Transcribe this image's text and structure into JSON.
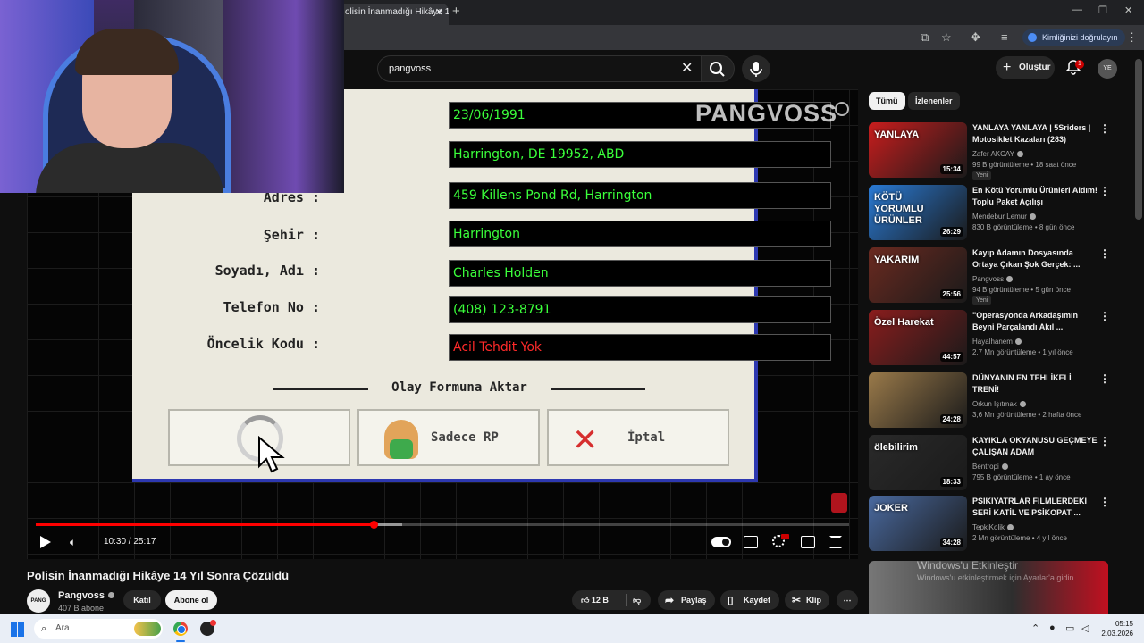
{
  "browser": {
    "tab_title": "olisin İnanmadığı Hikâye 1",
    "id_pill": "Kimliğinizi doğrulayın"
  },
  "header": {
    "search_value": "pangvoss",
    "create_label": "Oluştur",
    "notif_count": "1",
    "avatar_initials": "YE"
  },
  "player": {
    "watermark": "PANGVOSS",
    "form": {
      "partial_values": [
        "23/06/1991",
        "Harrington, DE 19952, ABD"
      ],
      "fields": [
        {
          "label": "Adres :",
          "value": "459 Killens Pond Rd, Harrington"
        },
        {
          "label": "Şehir :",
          "value": "Harrington"
        },
        {
          "label": "Soyadı, Adı :",
          "value": "Charles Holden"
        },
        {
          "label": "Telefon No :",
          "value": "(408) 123-8791"
        },
        {
          "label": "Öncelik Kodu :",
          "value": "Acil Tehdit Yok"
        }
      ],
      "section": "Olay Formuna Aktar",
      "button_rp": "Sadece RP",
      "button_cancel": "İptal"
    },
    "time": "10:30 / 25:17",
    "progress_fraction": 0.4152,
    "buffer_fraction": 0.45
  },
  "video": {
    "title": "Polisin İnanmadığı Hikâye 14 Yıl Sonra Çözüldü",
    "channel": "Pangvoss",
    "channel_logo": "PANG VOSS",
    "subs": "407 B abone",
    "join": "Katıl",
    "subscribe": "Abone ol",
    "likes": "12 B",
    "share": "Paylaş",
    "save": "Kaydet",
    "clip": "Klip"
  },
  "sidebar": {
    "chips": [
      "Tümü",
      "İzlenenler"
    ],
    "videos": [
      {
        "title": "YANLAYA YANLAYA | 5Sriders | Motosiklet Kazaları (283)",
        "channel": "Zafer AKCAY",
        "meta": "99 B görüntüleme • 18 saat önce",
        "duration": "15:34",
        "badge": "Yeni",
        "thumb_text": "YANLAYA",
        "thumb_color": "#c81d1d"
      },
      {
        "title": "En Kötü Yorumlu Ürünleri Aldım! Toplu Paket Açılışı",
        "channel": "Mendebur Lemur",
        "meta": "830 B görüntüleme • 8 gün önce",
        "duration": "26:29",
        "badge": "",
        "thumb_text": "KÖTÜ YORUMLU ÜRÜNLER",
        "thumb_color": "#2a7bd6"
      },
      {
        "title": "Kayıp Adamın Dosyasında Ortaya Çıkan Şok Gerçek: ...",
        "channel": "Pangvoss",
        "meta": "94 B görüntüleme • 5 gün önce",
        "duration": "25:56",
        "badge": "Yeni",
        "thumb_text": "YAKARIM",
        "thumb_color": "#6b2a20"
      },
      {
        "title": "\"Operasyonda Arkadaşımın Beyni Parçalandı Akıl ...",
        "channel": "Hayalhanem",
        "meta": "2,7 Mn görüntüleme • 1 yıl önce",
        "duration": "44:57",
        "badge": "",
        "thumb_text": "Özel Harekat",
        "thumb_color": "#8a1d1d"
      },
      {
        "title": "DÜNYANIN EN TEHLİKELİ TRENİ!",
        "channel": "Orkun Işıtmak",
        "meta": "3,6 Mn görüntüleme • 2 hafta önce",
        "duration": "24:28",
        "badge": "",
        "thumb_text": "",
        "thumb_color": "#9a7a4a"
      },
      {
        "title": "KAYIKLA OKYANUSU GEÇMEYE ÇALIŞAN ADAM",
        "channel": "Bentropi",
        "meta": "795 B görüntüleme • 1 ay önce",
        "duration": "18:33",
        "badge": "",
        "thumb_text": "ölebilirim",
        "thumb_color": "#2a2a2a"
      },
      {
        "title": "PSİKİYATRLAR FİLMLERDEKİ SERİ KATİL VE PSİKOPAT ...",
        "channel": "TepkiKolik",
        "meta": "2 Mn görüntüleme • 4 yıl önce",
        "duration": "34:28",
        "badge": "",
        "thumb_text": "JOKER",
        "thumb_color": "#4a6aa0"
      }
    ],
    "watermark1": "Windows'u Etkinleştir",
    "watermark2": "Windows'u etkinleştirmek için Ayarlar'a gidin."
  },
  "taskbar": {
    "search": "Ara",
    "time": "05:15",
    "date": "2.03.2026"
  },
  "icons": {
    "play": "play-icon",
    "volume": "volume-icon",
    "settings": "gear-icon",
    "fullscreen": "fullscreen-icon",
    "search": "search-icon",
    "mic": "mic-icon",
    "bell": "bell-icon",
    "like": "thumbs-up-icon",
    "share": "share-icon",
    "save": "bookmark-icon",
    "clip": "scissors-icon"
  }
}
